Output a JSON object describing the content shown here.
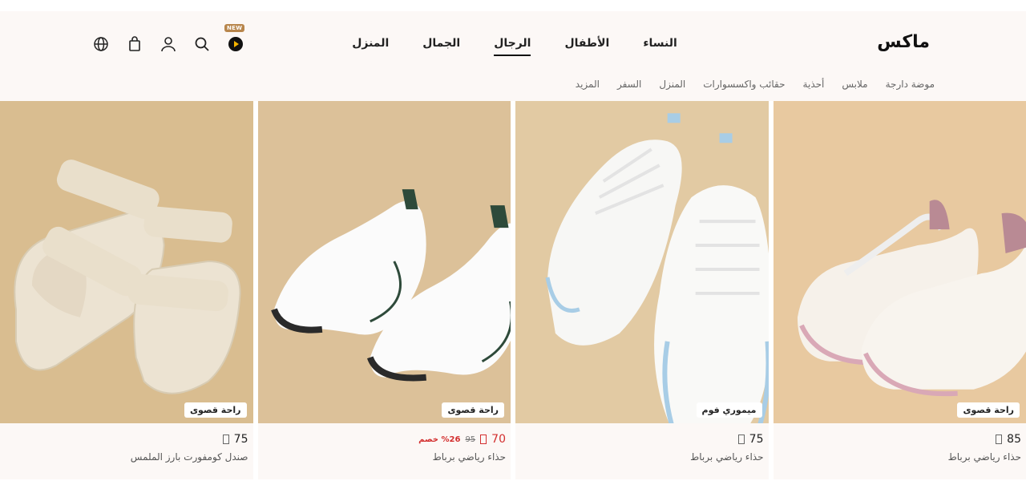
{
  "header": {
    "logo": "ماكس",
    "new_badge": "NEW",
    "main_nav": [
      "النساء",
      "الأطفال",
      "الرجال",
      "الجمال",
      "المنزل"
    ],
    "active_nav": "الرجال",
    "sub_nav": [
      "موضة دارجة",
      "ملابس",
      "أحذية",
      "حقائب واكسسوارات",
      "المنزل",
      "السفر",
      "المزيد"
    ],
    "icons": [
      "play-icon",
      "search-icon",
      "user-icon",
      "bag-icon",
      "globe-icon"
    ]
  },
  "products": [
    {
      "tag": "راحة قصوى",
      "price": "85",
      "name": "حذاء رياضي برباط",
      "old_price": "",
      "discount": "",
      "on_sale": false
    },
    {
      "tag": "ميموري فوم",
      "price": "75",
      "name": "حذاء رياضي برباط",
      "old_price": "",
      "discount": "",
      "on_sale": false
    },
    {
      "tag": "راحة قصوى",
      "price": "70",
      "name": "حذاء رياضي برباط",
      "old_price": "95",
      "discount": "%26 خصم",
      "on_sale": true
    },
    {
      "tag": "راحة قصوى",
      "price": "75",
      "name": "صندل كومفورت بارز الملمس",
      "old_price": "",
      "discount": "",
      "on_sale": false
    }
  ],
  "colors": {
    "header_bg": "#fcf8f6",
    "sale": "#d32f2f",
    "badge": "#b8864c",
    "image_backgrounds": [
      "#e8c9a0",
      "#e2caa3",
      "#dcc199",
      "#d9bd90"
    ]
  }
}
